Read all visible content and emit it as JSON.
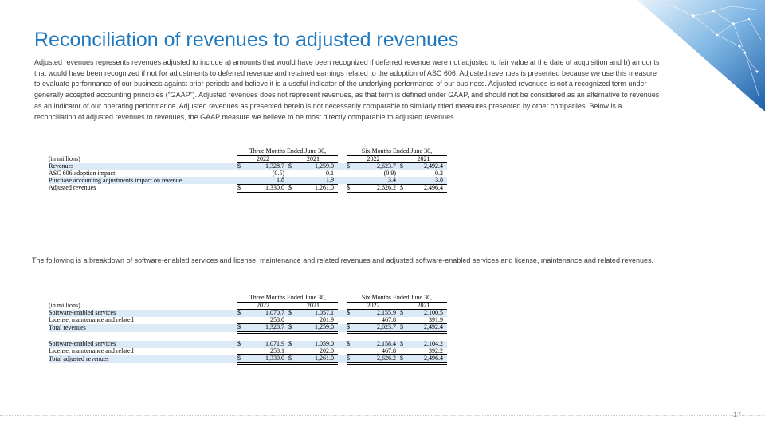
{
  "slide": {
    "title": "Reconciliation of revenues to adjusted revenues",
    "intro": "Adjusted revenues represents revenues adjusted to include a) amounts that would have been recognized if deferred revenue were not adjusted to fair value at the date of acquisition and b) amounts that would have been recognized if not for adjustments to deferred revenue and retained earnings related to the adoption of ASC 606.  Adjusted revenues is presented because we use this measure to evaluate performance of our business against prior periods and believe it is a useful indicator of the underlying performance of our business.  Adjusted revenues is not a recognized term under generally accepted accounting principles (“GAAP”).  Adjusted revenues does not represent revenues, as that term is defined under GAAP, and should not be considered as an alternative to revenues as an indicator of our operating performance.  Adjusted revenues as presented herein is not necessarily comparable to similarly titled measures presented by other companies.  Below is a reconciliation of adjusted revenues to revenues, the GAAP measure we believe to be most directly comparable to adjusted revenues.",
    "breakdown_text": "The following is a breakdown of software-enabled services and license, maintenance and related revenues and adjusted software-enabled services and license, maintenance and related revenues.",
    "page_number": "17"
  },
  "table1": {
    "group_three": "Three Months Ended June 30,",
    "group_six": "Six Months Ended June 30,",
    "units": "(in millions)",
    "years": [
      "2022",
      "2021",
      "2022",
      "2021"
    ],
    "rows": [
      {
        "label": "Revenues",
        "dollar": true,
        "values": [
          "1,328.7",
          "1,259.0",
          "2,623.7",
          "2,492.4"
        ],
        "shade": true
      },
      {
        "label": "ASC 606 adoption impact",
        "dollar": false,
        "values": [
          "(0.5)",
          "0.1",
          "(0.9)",
          "0.2"
        ],
        "shade": false
      },
      {
        "label": "Purchase accounting adjustments impact on revenue",
        "dollar": false,
        "values": [
          "1.8",
          "1.9",
          "3.4",
          "3.8"
        ],
        "shade": true
      },
      {
        "label": "Adjusted revenues",
        "dollar": true,
        "values": [
          "1,330.0",
          "1,261.0",
          "2,626.2",
          "2,496.4"
        ],
        "shade": false,
        "total": true
      }
    ]
  },
  "table2": {
    "group_three": "Three Months Ended June 30,",
    "group_six": "Six Months Ended June 30,",
    "units": "(in millions)",
    "years": [
      "2022",
      "2021",
      "2022",
      "2021"
    ],
    "rows": [
      {
        "label": "Software-enabled services",
        "dollar": true,
        "values": [
          "1,070.7",
          "1,057.1",
          "2,155.9",
          "2,100.5"
        ],
        "shade": true
      },
      {
        "label": "License, maintenance and related",
        "dollar": false,
        "values": [
          "258.0",
          "201.9",
          "467.8",
          "391.9"
        ],
        "shade": false
      },
      {
        "label": "Total revenues",
        "dollar": true,
        "values": [
          "1,328.7",
          "1,259.0",
          "2,623.7",
          "2,492.4"
        ],
        "shade": true,
        "total": true
      },
      {
        "spacer": true
      },
      {
        "label": "Software-enabled services",
        "dollar": true,
        "values": [
          "1,071.9",
          "1,059.0",
          "2,158.4",
          "2,104.2"
        ],
        "shade": true
      },
      {
        "label": "License, maintenance and related",
        "dollar": false,
        "values": [
          "258.1",
          "202.0",
          "467.8",
          "392.2"
        ],
        "shade": false
      },
      {
        "label": "Total adjusted revenues",
        "dollar": true,
        "values": [
          "1,330.0",
          "1,261.0",
          "2,626.2",
          "2,496.4"
        ],
        "shade": true,
        "total": true
      }
    ]
  }
}
